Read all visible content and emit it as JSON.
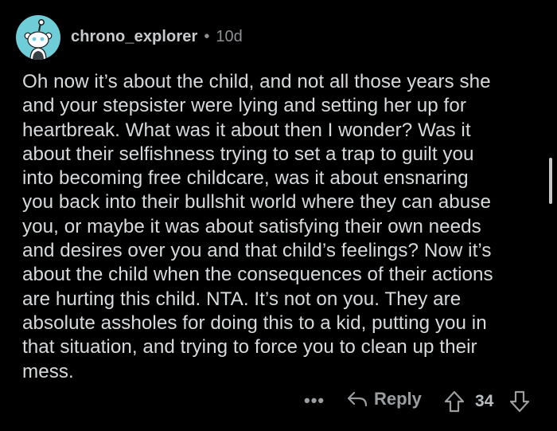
{
  "comment": {
    "username": "chrono_explorer",
    "separator": "•",
    "age": "10d",
    "body_lines": [
      "Oh now it’s about the child, and not all those years she",
      "and your stepsister were lying and setting her up for",
      "heartbreak. What was it about then I wonder? Was it",
      "about their selfishness trying to set a trap to guilt you",
      "into becoming free childcare, was it about ensnaring",
      "you back into their bullshit world where they can abuse",
      "you, or maybe it was about satisfying their own needs",
      "and desires over you and that child’s feelings? Now it’s",
      "about the child when the consequences of their actions",
      "are hurting this child. NTA. It’s not on you. They are",
      "absolute assholes for doing this to a kid, putting you in",
      "that situation, and trying to force you to clean up their",
      "mess."
    ]
  },
  "actions": {
    "more_label": "•••",
    "reply_label": "Reply",
    "score": "34"
  },
  "icons": {
    "avatar": "snoo-avatar-icon",
    "reply": "reply-arrow-icon",
    "upvote": "upvote-arrow-icon",
    "downvote": "downvote-arrow-icon"
  },
  "colors": {
    "background": "#000000",
    "text": "#d7dadc",
    "muted": "#8d9194",
    "avatar_bg": "#6fcdd8"
  }
}
